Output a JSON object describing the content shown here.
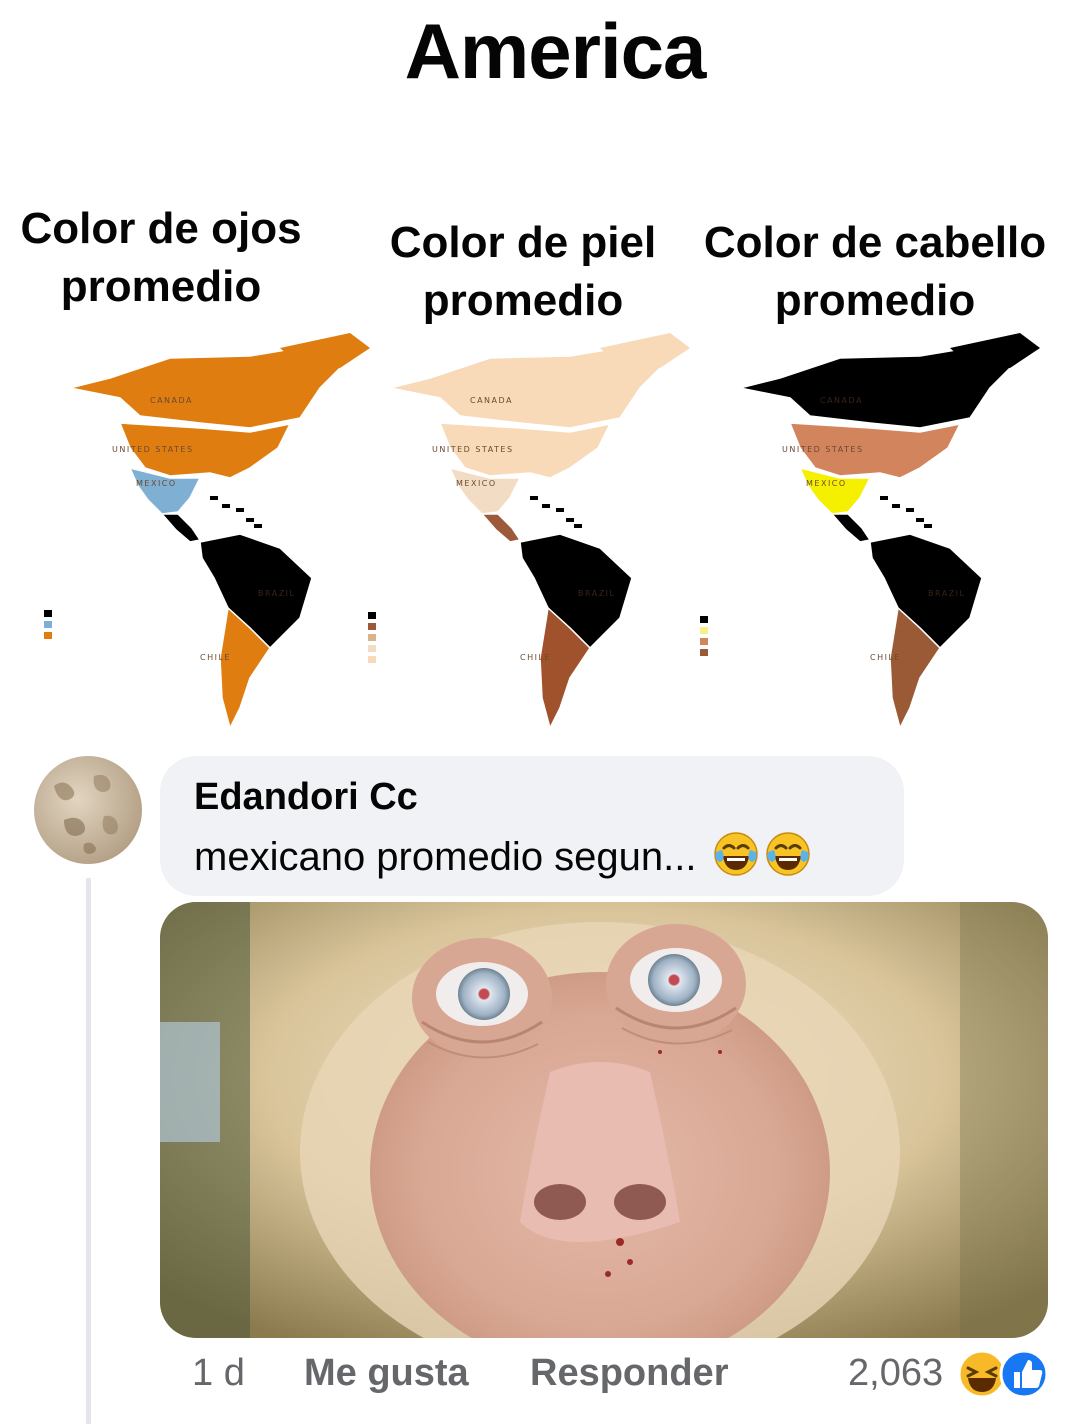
{
  "meme": {
    "title": "America",
    "maps": [
      {
        "title_line1": "Color de ojos",
        "title_line2": "promedio",
        "labels": [
          "CANADA",
          "UNITED STATES",
          "MEXICO",
          "BRAZIL",
          "CHILE"
        ],
        "colors": {
          "canada": "#e07d10",
          "usa": "#e07d10",
          "mexico": "#7fb0d3",
          "central": "#000000",
          "south": "#000000",
          "southern_cone": "#e07d10"
        },
        "legend": [
          "#000000",
          "#7fb0d3",
          "#e07d10"
        ]
      },
      {
        "title_line1": "Color de piel",
        "title_line2": "promedio",
        "labels": [
          "CANADA",
          "UNITED STATES",
          "MEXICO",
          "BRAZIL",
          "CHILE"
        ],
        "colors": {
          "canada": "#f8d9b8",
          "usa": "#f8d9b8",
          "mexico": "#f2ddc4",
          "central": "#9c5a3a",
          "south": "#000000",
          "southern_cone": "#a0522d"
        },
        "legend": [
          "#000000",
          "#9c5a3a",
          "#d9b38c",
          "#f2ddc4",
          "#f8d9b8"
        ]
      },
      {
        "title_line1": "Color de cabello",
        "title_line2": "promedio",
        "labels": [
          "CANADA",
          "UNITED STATES",
          "MEXICO",
          "BRAZIL",
          "CHILE"
        ],
        "colors": {
          "canada": "#000000",
          "usa": "#d2845d",
          "mexico": "#f5ef00",
          "central": "#000000",
          "south": "#000000",
          "southern_cone": "#9a5a35"
        },
        "legend": [
          "#000000",
          "#f7f08a",
          "#d2845d",
          "#9a5a35"
        ]
      }
    ]
  },
  "comment": {
    "author": "Edandori Cc",
    "text": "mexicano promedio segun...",
    "emojis": [
      "face-with-tears-of-joy",
      "face-with-tears-of-joy"
    ],
    "time": "1 d",
    "like_label": "Me gusta",
    "reply_label": "Responder",
    "reaction_count": "2,063",
    "reaction_icons": [
      "laughing-reaction",
      "like-reaction"
    ]
  },
  "colors": {
    "bubble_bg": "#f0f2f5",
    "meta_text": "#65676b",
    "like_blue": "#1877f2",
    "haha_yellow": "#f7b928"
  }
}
